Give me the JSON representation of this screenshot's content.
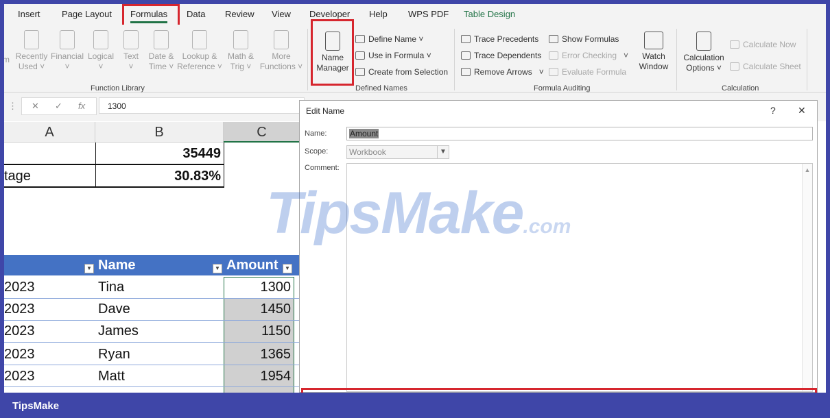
{
  "ribbon_tabs": {
    "insert": "Insert",
    "page_layout": "Page Layout",
    "formulas": "Formulas",
    "data": "Data",
    "review": "Review",
    "view": "View",
    "developer": "Developer",
    "help": "Help",
    "wps_pdf": "WPS PDF",
    "table_design": "Table Design"
  },
  "function_library": {
    "group_label": "Function Library",
    "autosum_partial": "m",
    "recently_used": [
      "Recently",
      "Used ˅"
    ],
    "financial": [
      "Financial",
      "˅"
    ],
    "logical": [
      "Logical",
      "˅"
    ],
    "text": [
      "Text",
      "˅"
    ],
    "date_time": [
      "Date &",
      "Time ˅"
    ],
    "lookup": [
      "Lookup &",
      "Reference ˅"
    ],
    "math": [
      "Math &",
      "Trig ˅"
    ],
    "more": [
      "More",
      "Functions ˅"
    ]
  },
  "defined_names": {
    "group_label": "Defined Names",
    "name_manager": [
      "Name",
      "Manager"
    ],
    "define_name": "Define Name ˅",
    "use_in_formula": "Use in Formula ˅",
    "create_from_selection": "Create from Selection"
  },
  "formula_auditing": {
    "group_label": "Formula Auditing",
    "trace_precedents": "Trace Precedents",
    "trace_dependents": "Trace Dependents",
    "remove_arrows": "Remove Arrows",
    "remove_arrows_arrow": "˅",
    "show_formulas": "Show Formulas",
    "error_checking": "Error Checking",
    "error_checking_arrow": "˅",
    "evaluate_formula": "Evaluate Formula",
    "watch_window": [
      "Watch",
      "Window"
    ]
  },
  "calculation": {
    "group_label": "Calculation",
    "calculation_options": [
      "Calculation",
      "Options ˅"
    ],
    "calculate_now": "Calculate Now",
    "calculate_sheet": "Calculate Sheet"
  },
  "formula_bar": {
    "value": "1300",
    "cancel_symbol": "✕",
    "enter_symbol": "✓",
    "fx_symbol": "fx",
    "more_symbol": "⋮"
  },
  "grid": {
    "columns": [
      "A",
      "B",
      "C"
    ],
    "summary": [
      {
        "a": "",
        "b": "35449"
      },
      {
        "a": "tage",
        "b": "30.83%"
      }
    ],
    "table_headers": {
      "name": "Name",
      "amount": "Amount"
    },
    "rows": [
      {
        "date": "2023",
        "name": "Tina",
        "amount": "1300"
      },
      {
        "date": "2023",
        "name": "Dave",
        "amount": "1450"
      },
      {
        "date": "2023",
        "name": "James",
        "amount": "1150"
      },
      {
        "date": "2023",
        "name": "Ryan",
        "amount": "1365"
      },
      {
        "date": "2023",
        "name": "Matt",
        "amount": "1954"
      }
    ]
  },
  "dialog": {
    "title": "Edit Name",
    "help": "?",
    "close": "✕",
    "name_label": "Name:",
    "name_value": "Amount",
    "scope_label": "Scope:",
    "scope_value": "Workbook",
    "comment_label": "Comment:"
  },
  "watermark": {
    "main": "TipsMake",
    "suffix": ".com"
  },
  "footer": {
    "brand": "TipsMake"
  },
  "colors": {
    "accent": "#217346",
    "highlight": "#d6262e",
    "table_header": "#4472c4",
    "footer": "#3f46a8"
  }
}
